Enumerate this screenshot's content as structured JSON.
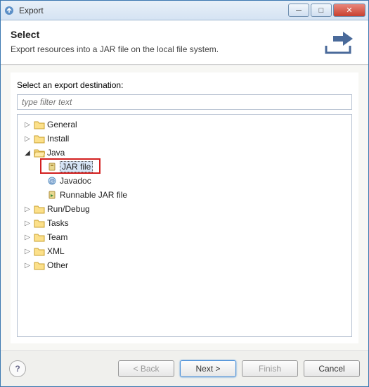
{
  "window": {
    "title": "Export"
  },
  "header": {
    "title": "Select",
    "description": "Export resources into a JAR file on the local file system."
  },
  "content": {
    "label": "Select an export destination:",
    "filter_placeholder": "type filter text"
  },
  "tree": {
    "items": [
      {
        "label": "General"
      },
      {
        "label": "Install"
      },
      {
        "label": "Java",
        "expanded": true,
        "children": [
          {
            "label": "JAR file",
            "selected": true
          },
          {
            "label": "Javadoc"
          },
          {
            "label": "Runnable JAR file"
          }
        ]
      },
      {
        "label": "Run/Debug"
      },
      {
        "label": "Tasks"
      },
      {
        "label": "Team"
      },
      {
        "label": "XML"
      },
      {
        "label": "Other"
      }
    ]
  },
  "buttons": {
    "back": "< Back",
    "next": "Next >",
    "finish": "Finish",
    "cancel": "Cancel"
  }
}
